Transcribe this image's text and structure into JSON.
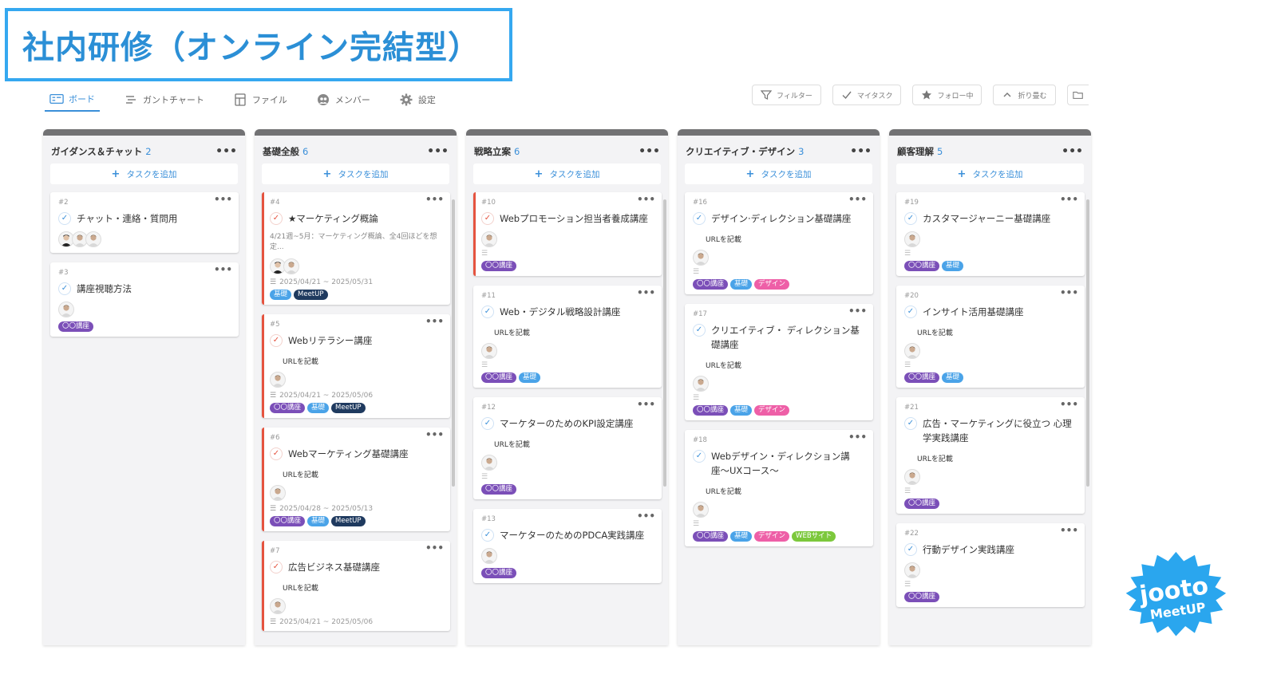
{
  "banner": {
    "title": "社内研修（オンライン完結型）"
  },
  "tabs": [
    {
      "label": "ボード",
      "icon": "board-icon",
      "active": true
    },
    {
      "label": "ガントチャート",
      "icon": "gantt-icon"
    },
    {
      "label": "ファイル",
      "icon": "file-icon"
    },
    {
      "label": "メンバー",
      "icon": "member-icon"
    },
    {
      "label": "設定",
      "icon": "gear-icon"
    }
  ],
  "toolbar": {
    "filter": "フィルター",
    "my_tasks": "マイタスク",
    "following": "フォロー中",
    "collapse": "折り畳む"
  },
  "add_task_label": "タスクを追加",
  "tag_colors": {
    "〇〇講座": "#7b4fb8",
    "基礎": "#4aa3e8",
    "MeetUP": "#1f3a5f",
    "デザイン": "#ee5fa7",
    "WEBサイト": "#7cc83c"
  },
  "columns": [
    {
      "title": "ガイダンス＆チャット",
      "count": "2",
      "cards": [
        {
          "id": "#2",
          "title": "チャット・連絡・質問用",
          "check": "blue",
          "avatars": 3,
          "tags": []
        },
        {
          "id": "#3",
          "title": "講座視聴方法",
          "check": "blue",
          "avatars": 1,
          "tags": [
            "〇〇講座"
          ]
        }
      ]
    },
    {
      "title": "基礎全般",
      "count": "6",
      "cards": [
        {
          "id": "#4",
          "title": "★マーケティング概論",
          "check": "red",
          "red": true,
          "desc": "4/21週~5月：マーケティング概論、全4回ほどを想定...",
          "avatars": 2,
          "date": "2025/04/21 ~ 2025/05/31",
          "tags": [
            "基礎",
            "MeetUP"
          ]
        },
        {
          "id": "#5",
          "title": "Webリテラシー講座",
          "check": "red",
          "red": true,
          "url": "URLを記載",
          "avatars": 1,
          "date": "2025/04/21 ~ 2025/05/06",
          "tags": [
            "〇〇講座",
            "基礎",
            "MeetUP"
          ]
        },
        {
          "id": "#6",
          "title": "Webマーケティング基礎講座",
          "check": "red",
          "red": true,
          "url": "URLを記載",
          "avatars": 1,
          "date": "2025/04/28 ~ 2025/05/13",
          "tags": [
            "〇〇講座",
            "基礎",
            "MeetUP"
          ]
        },
        {
          "id": "#7",
          "title": "広告ビジネス基礎講座",
          "check": "red",
          "red": true,
          "url": "URLを記載",
          "avatars": 1,
          "date": "2025/04/21 ~ 2025/05/06",
          "tags": []
        }
      ]
    },
    {
      "title": "戦略立案",
      "count": "6",
      "cards": [
        {
          "id": "#10",
          "title": "Webプロモーション担当者養成講座",
          "check": "red",
          "red": true,
          "avatars": 1,
          "lines": true,
          "tags": [
            "〇〇講座"
          ]
        },
        {
          "id": "#11",
          "title": "Web・デジタル戦略設計講座",
          "check": "blue",
          "url": "URLを記載",
          "avatars": 1,
          "lines": true,
          "tags": [
            "〇〇講座",
            "基礎"
          ]
        },
        {
          "id": "#12",
          "title": "マーケターのためのKPI設定講座",
          "check": "blue",
          "url": "URLを記載",
          "avatars": 1,
          "lines": true,
          "tags": [
            "〇〇講座"
          ]
        },
        {
          "id": "#13",
          "title": "マーケターのためのPDCA実践講座",
          "check": "blue",
          "avatars": 1,
          "tags": [
            "〇〇講座"
          ]
        }
      ]
    },
    {
      "title": "クリエイティブ・デザイン",
      "count": "3",
      "cards": [
        {
          "id": "#16",
          "title": "デザイン·ディレクション基礎講座",
          "check": "blue",
          "url": "URLを記載",
          "avatars": 1,
          "lines": true,
          "tags": [
            "〇〇講座",
            "基礎",
            "デザイン"
          ]
        },
        {
          "id": "#17",
          "title": "クリエイティブ・ ディレクション基礎講座",
          "check": "blue",
          "url": "URLを記載",
          "avatars": 1,
          "lines": true,
          "tags": [
            "〇〇講座",
            "基礎",
            "デザイン"
          ]
        },
        {
          "id": "#18",
          "title": "Webデザイン・ディレクション講座〜UXコース〜",
          "check": "blue",
          "url": "URLを記載",
          "avatars": 1,
          "lines": true,
          "tags": [
            "〇〇講座",
            "基礎",
            "デザイン",
            "WEBサイト"
          ]
        }
      ]
    },
    {
      "title": "顧客理解",
      "count": "5",
      "cards": [
        {
          "id": "#19",
          "title": "カスタマージャーニー基礎講座",
          "check": "blue",
          "avatars": 1,
          "lines": true,
          "tags": [
            "〇〇講座",
            "基礎"
          ]
        },
        {
          "id": "#20",
          "title": "インサイト活用基礎講座",
          "check": "blue",
          "url": "URLを記載",
          "avatars": 1,
          "lines": true,
          "tags": [
            "〇〇講座",
            "基礎"
          ]
        },
        {
          "id": "#21",
          "title": "広告・マーケティングに役立つ 心理学実践講座",
          "check": "blue",
          "url": "URLを記載",
          "avatars": 1,
          "lines": true,
          "tags": [
            "〇〇講座"
          ]
        },
        {
          "id": "#22",
          "title": "行動デザイン実践講座",
          "check": "blue",
          "avatars": 1,
          "lines": true,
          "tags": [
            "〇〇講座"
          ]
        }
      ]
    }
  ],
  "logo": {
    "line1": "jooto",
    "line2": "MeetUP"
  }
}
